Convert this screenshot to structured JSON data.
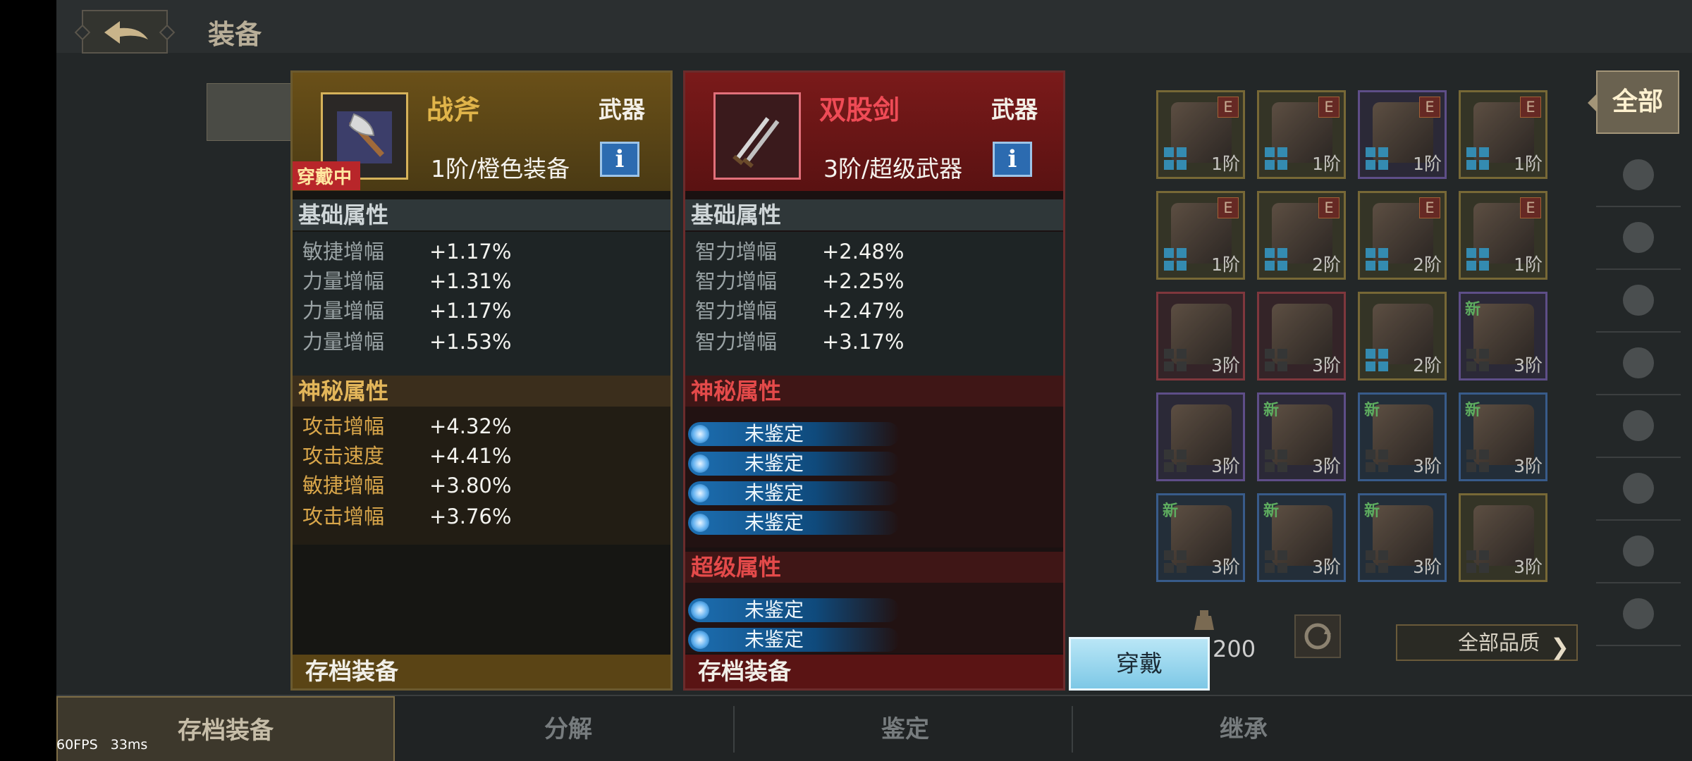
{
  "header": {
    "title": "装备"
  },
  "equipped_card": {
    "name": "战斧",
    "type": "武器",
    "tier": "1阶/橙色装备",
    "equipped_tag": "穿戴中",
    "base_title": "基础属性",
    "base_stats": [
      {
        "label": "敏捷增幅",
        "value": "+1.17%"
      },
      {
        "label": "力量增幅",
        "value": "+1.31%"
      },
      {
        "label": "力量增幅",
        "value": "+1.17%"
      },
      {
        "label": "力量增幅",
        "value": "+1.53%"
      }
    ],
    "mystic_title": "神秘属性",
    "mystic_stats": [
      {
        "label": "攻击增幅",
        "value": "+4.32%"
      },
      {
        "label": "攻击速度",
        "value": "+4.41%"
      },
      {
        "label": "敏捷增幅",
        "value": "+3.80%"
      },
      {
        "label": "攻击增幅",
        "value": "+3.76%"
      }
    ],
    "footer": "存档装备"
  },
  "compare_card": {
    "name": "双股剑",
    "type": "武器",
    "tier": "3阶/超级武器",
    "base_title": "基础属性",
    "base_stats": [
      {
        "label": "智力增幅",
        "value": "+2.48%"
      },
      {
        "label": "智力增幅",
        "value": "+2.25%"
      },
      {
        "label": "智力增幅",
        "value": "+2.47%"
      },
      {
        "label": "智力增幅",
        "value": "+3.17%"
      }
    ],
    "mystic_title": "神秘属性",
    "mystic_unidentified": [
      "未鉴定",
      "未鉴定",
      "未鉴定",
      "未鉴定"
    ],
    "super_title": "超级属性",
    "super_unidentified": [
      "未鉴定",
      "未鉴定"
    ],
    "footer": "存档装备"
  },
  "equip_button": "穿戴",
  "inventory": [
    {
      "icon": "axe-icon",
      "tier": "1阶",
      "badge": "E",
      "rarity": "gold"
    },
    {
      "icon": "helmet-icon",
      "tier": "1阶",
      "badge": "E",
      "rarity": "gold"
    },
    {
      "icon": "armor-icon",
      "tier": "1阶",
      "badge": "E",
      "rarity": "purple"
    },
    {
      "icon": "gauntlet-icon",
      "tier": "1阶",
      "badge": "E",
      "rarity": "gold"
    },
    {
      "icon": "belt-icon",
      "tier": "1阶",
      "badge": "E",
      "rarity": "gold"
    },
    {
      "icon": "leggings-icon",
      "tier": "2阶",
      "badge": "E",
      "rarity": "gold"
    },
    {
      "icon": "ring-icon",
      "tier": "2阶",
      "badge": "E",
      "rarity": "gold"
    },
    {
      "icon": "necklace-icon",
      "tier": "1阶",
      "badge": "E",
      "rarity": "gold"
    },
    {
      "icon": "twin-swords-icon",
      "tier": "3阶",
      "badge": "",
      "rarity": "red"
    },
    {
      "icon": "bow-icon",
      "tier": "3阶",
      "badge": "",
      "rarity": "red"
    },
    {
      "icon": "amulet-icon",
      "tier": "2阶",
      "badge": "",
      "rarity": "gold"
    },
    {
      "icon": "helmet-icon",
      "tier": "3阶",
      "badge": "新",
      "rarity": "purple"
    },
    {
      "icon": "armor-icon",
      "tier": "3阶",
      "badge": "",
      "rarity": "purple"
    },
    {
      "icon": "ring-icon",
      "tier": "3阶",
      "badge": "新",
      "rarity": "purple"
    },
    {
      "icon": "dagger-icon",
      "tier": "3阶",
      "badge": "新",
      "rarity": "blue"
    },
    {
      "icon": "cloak-icon",
      "tier": "3阶",
      "badge": "新",
      "rarity": "blue"
    },
    {
      "icon": "armor-icon",
      "tier": "3阶",
      "badge": "新",
      "rarity": "blue"
    },
    {
      "icon": "bow-icon",
      "tier": "3阶",
      "badge": "新",
      "rarity": "blue"
    },
    {
      "icon": "ring-icon",
      "tier": "3阶",
      "badge": "新",
      "rarity": "blue"
    },
    {
      "icon": "boots-icon",
      "tier": "3阶",
      "badge": "",
      "rarity": "gold"
    }
  ],
  "inventory_count": "200",
  "quality_filter": "全部品质",
  "categories": {
    "all_label": "全部",
    "icons": [
      "crossed-swords-icon",
      "helmet-icon",
      "armor-icon",
      "gauntlet-icon",
      "belt-icon",
      "boots-icon",
      "ring-icon",
      "necklace-icon"
    ]
  },
  "bottom_tabs": [
    "存档装备",
    "分解",
    "鉴定",
    "继承"
  ],
  "debug": {
    "fps": "60FPS",
    "ms": "33ms"
  },
  "colors": {
    "gold_accent": "#e0b44a",
    "red_accent": "#ef4b56",
    "equip_button": "#9bd8ef"
  }
}
